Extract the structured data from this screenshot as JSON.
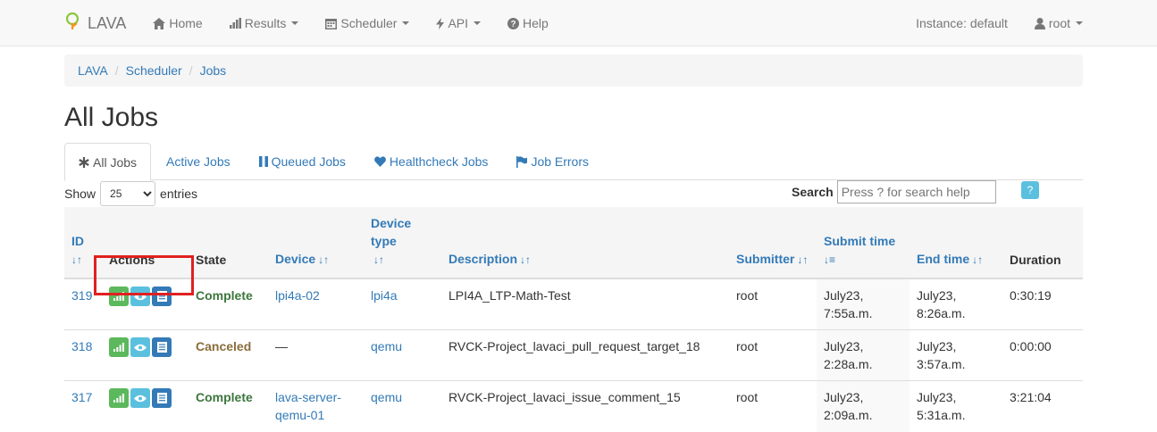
{
  "navbar": {
    "brand": "LAVA",
    "items": [
      {
        "label": "Home",
        "icon": "home-icon"
      },
      {
        "label": "Results",
        "icon": "bar-chart-icon"
      },
      {
        "label": "Scheduler",
        "icon": "calendar-icon"
      },
      {
        "label": "API",
        "icon": "flash-icon"
      },
      {
        "label": "Help",
        "icon": "question-icon"
      }
    ],
    "instance": "Instance: default",
    "user": "root"
  },
  "breadcrumb": [
    "LAVA",
    "Scheduler",
    "Jobs"
  ],
  "page_title": "All Jobs",
  "tabs": [
    {
      "label": "All Jobs",
      "icon": "asterisk-icon",
      "active": true
    },
    {
      "label": "Active Jobs",
      "icon": "",
      "active": false
    },
    {
      "label": "Queued Jobs",
      "icon": "pause-icon",
      "active": false
    },
    {
      "label": "Healthcheck Jobs",
      "icon": "heart-icon",
      "active": false
    },
    {
      "label": "Job Errors",
      "icon": "flag-icon",
      "active": false
    }
  ],
  "controls": {
    "show_label": "Show",
    "entries_value": "25",
    "entries_label": "entries",
    "search_label": "Search",
    "search_placeholder": "Press ? for search help",
    "help_button": "?"
  },
  "table": {
    "headers": {
      "id": "ID",
      "actions": "Actions",
      "state": "State",
      "device": "Device",
      "device_type": "Device type",
      "description": "Description",
      "submitter": "Submitter",
      "submit_time": "Submit time",
      "end_time": "End time",
      "duration": "Duration"
    },
    "rows": [
      {
        "id": "319",
        "state": "Complete",
        "device": "lpi4a-02",
        "device_type": "lpi4a",
        "description": "LPI4A_LTP-Math-Test",
        "submitter": "root",
        "submit_time": "July23, 7:55a.m.",
        "end_time": "July23, 8:26a.m.",
        "duration": "0:30:19"
      },
      {
        "id": "318",
        "state": "Canceled",
        "device": "—",
        "device_type": "qemu",
        "description": "RVCK-Project_lavaci_pull_request_target_18",
        "submitter": "root",
        "submit_time": "July23, 2:28a.m.",
        "end_time": "July23, 3:57a.m.",
        "duration": "0:00:00"
      },
      {
        "id": "317",
        "state": "Complete",
        "device": "lava-server-qemu-01",
        "device_type": "qemu",
        "description": "RVCK-Project_lavaci_issue_comment_15",
        "submitter": "root",
        "submit_time": "July23, 2:09a.m.",
        "end_time": "July23, 5:31a.m.",
        "duration": "3:21:04"
      }
    ]
  },
  "colors": {
    "link": "#337ab7",
    "complete": "#3c763d",
    "canceled": "#8a6d3b",
    "btn_green": "#5cb85c",
    "btn_cyan": "#5bc0de",
    "btn_blue": "#337ab7",
    "highlight": "#e02020"
  }
}
